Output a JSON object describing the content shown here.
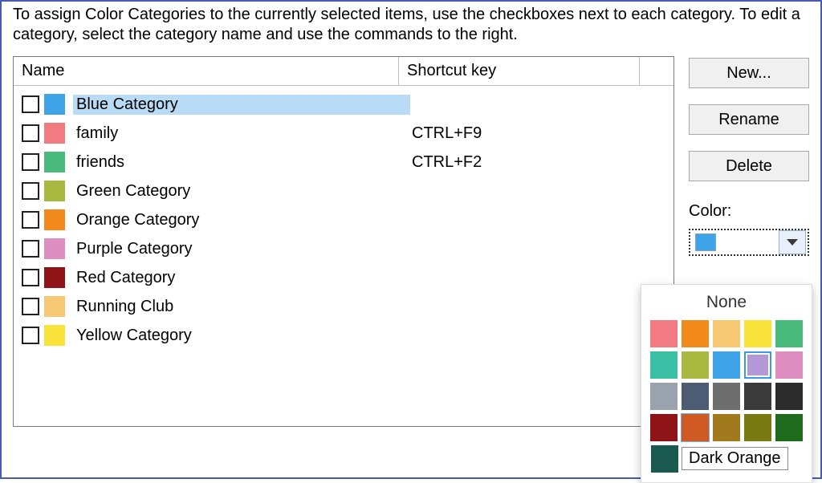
{
  "instruction": "To assign Color Categories to the currently selected items, use the checkboxes next to each category.  To edit a category, select the category name and use the commands to the right.",
  "columns": {
    "name": "Name",
    "shortcut": "Shortcut key"
  },
  "categories": [
    {
      "label": "Blue Category",
      "color": "#3fa3e8",
      "shortcut": "",
      "selected": true
    },
    {
      "label": "family",
      "color": "#f27b81",
      "shortcut": "CTRL+F9",
      "selected": false
    },
    {
      "label": "friends",
      "color": "#4ab97c",
      "shortcut": "CTRL+F2",
      "selected": false
    },
    {
      "label": "Green Category",
      "color": "#a9b83e",
      "shortcut": "",
      "selected": false
    },
    {
      "label": "Orange Category",
      "color": "#f28a1c",
      "shortcut": "",
      "selected": false
    },
    {
      "label": "Purple Category",
      "color": "#de8ec0",
      "shortcut": "",
      "selected": false
    },
    {
      "label": "Red Category",
      "color": "#8f1417",
      "shortcut": "",
      "selected": false
    },
    {
      "label": "Running Club",
      "color": "#f6c873",
      "shortcut": "",
      "selected": false
    },
    {
      "label": "Yellow Category",
      "color": "#f9e33b",
      "shortcut": "",
      "selected": false
    }
  ],
  "buttons": {
    "new": "New...",
    "rename": "Rename",
    "delete": "Delete"
  },
  "color_section": {
    "label": "Color:",
    "current_color": "#3fa3e8"
  },
  "color_popup": {
    "none_label": "None",
    "tooltip": "Dark Orange",
    "grid": [
      [
        "#f27b81",
        "#f28a1c",
        "#f6c873",
        "#f9e33b",
        "#4ab97c"
      ],
      [
        "#3bbfa4",
        "#a9b83e",
        "#3fa3e8",
        "#b39ad6",
        "#de8ec0"
      ],
      [
        "#9aa2ae",
        "#4b5c74",
        "#6e6e6e",
        "#3a3a3a",
        "#2c2c2c"
      ],
      [
        "#8f1417",
        "#d05a23",
        "#a07a1d",
        "#7a7a12",
        "#1e6b1e"
      ]
    ],
    "current_index": {
      "row": 1,
      "col": 3
    },
    "hover_index": {
      "row": 3,
      "col": 1
    },
    "extra": "#1a5a50"
  }
}
